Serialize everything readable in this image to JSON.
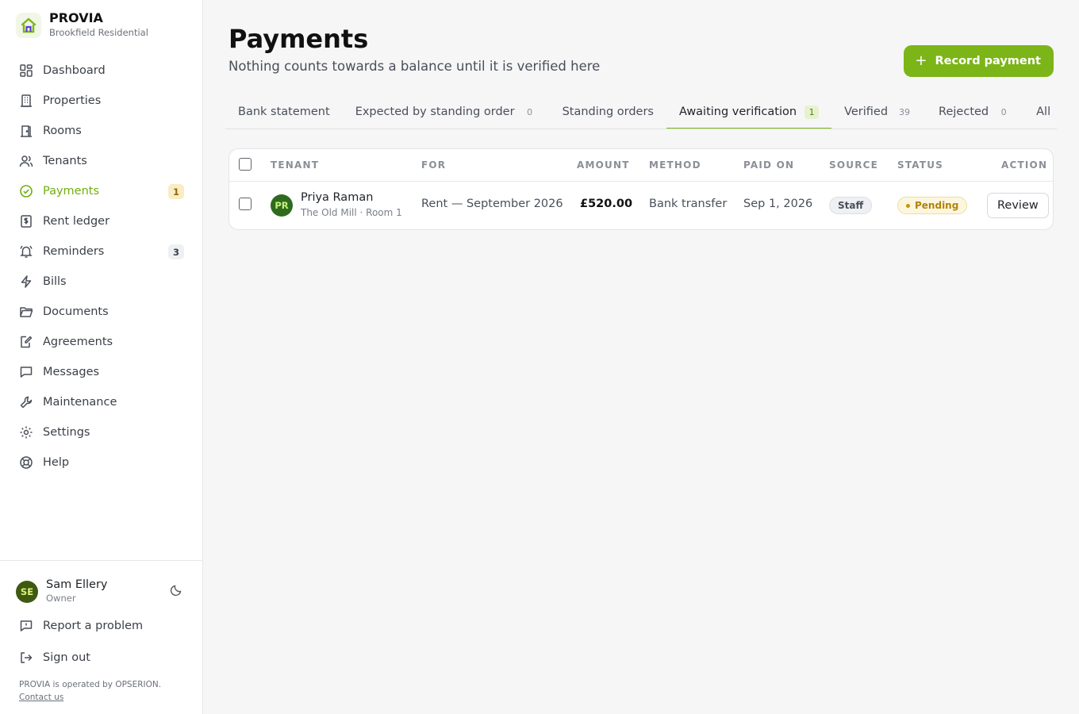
{
  "brand": {
    "name": "PROVIA",
    "subtitle": "Brookfield Residential"
  },
  "sidebar": {
    "items": [
      {
        "label": "Dashboard",
        "icon": "dashboard-icon"
      },
      {
        "label": "Properties",
        "icon": "building-icon"
      },
      {
        "label": "Rooms",
        "icon": "door-icon"
      },
      {
        "label": "Tenants",
        "icon": "users-icon"
      },
      {
        "label": "Payments",
        "icon": "check-circle-icon",
        "active": true,
        "badge": "1"
      },
      {
        "label": "Rent ledger",
        "icon": "ledger-icon"
      },
      {
        "label": "Reminders",
        "icon": "bell-icon",
        "badge": "3"
      },
      {
        "label": "Bills",
        "icon": "bolt-icon"
      },
      {
        "label": "Documents",
        "icon": "folder-icon"
      },
      {
        "label": "Agreements",
        "icon": "pen-doc-icon"
      },
      {
        "label": "Messages",
        "icon": "chat-icon"
      },
      {
        "label": "Maintenance",
        "icon": "wrench-icon"
      },
      {
        "label": "Settings",
        "icon": "gear-icon"
      },
      {
        "label": "Help",
        "icon": "lifebuoy-icon"
      }
    ]
  },
  "user": {
    "initials": "SE",
    "name": "Sam Ellery",
    "role": "Owner"
  },
  "bottom_links": {
    "report": "Report a problem",
    "signout": "Sign out"
  },
  "footer": {
    "note": "PROVIA is operated by OPSERION.",
    "contact": "Contact us"
  },
  "page": {
    "title": "Payments",
    "subtitle": "Nothing counts towards a balance until it is verified here",
    "record_button": "Record payment"
  },
  "tabs": [
    {
      "label": "Bank statement"
    },
    {
      "label": "Expected by standing order",
      "count": "0"
    },
    {
      "label": "Standing orders"
    },
    {
      "label": "Awaiting verification",
      "count": "1",
      "active": true
    },
    {
      "label": "Verified",
      "count": "39"
    },
    {
      "label": "Rejected",
      "count": "0"
    },
    {
      "label": "All"
    }
  ],
  "table": {
    "headers": [
      "TENANT",
      "FOR",
      "AMOUNT",
      "METHOD",
      "PAID ON",
      "SOURCE",
      "STATUS",
      "ACTION"
    ],
    "rows": [
      {
        "initials": "PR",
        "tenant": "Priya Raman",
        "location": "The Old Mill · Room 1",
        "for": "Rent — September 2026",
        "amount": "£520.00",
        "method": "Bank transfer",
        "paid_on": "Sep 1, 2026",
        "source": "Staff",
        "status": "Pending",
        "action": "Review"
      }
    ]
  },
  "colors": {
    "accent": "#7cb518",
    "active_nav": "#6fae0f",
    "pending": "#b08209"
  }
}
